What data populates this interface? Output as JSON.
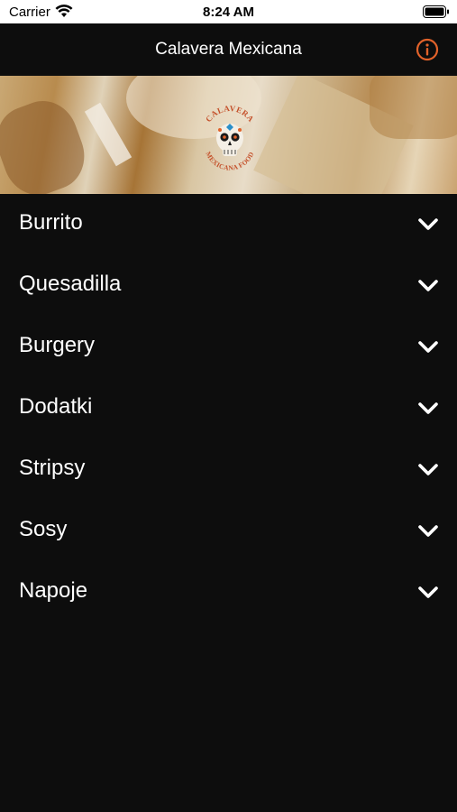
{
  "status": {
    "carrier": "Carrier",
    "time": "8:24 AM"
  },
  "header": {
    "title": "Calavera Mexicana",
    "info_icon": "info-circle-icon",
    "accent_color": "#e2622a"
  },
  "hero": {
    "logo_text_top": "CALAVERA",
    "logo_text_bottom": "MEXICANA FOOD"
  },
  "menu": {
    "items": [
      {
        "label": "Burrito"
      },
      {
        "label": "Quesadilla"
      },
      {
        "label": "Burgery"
      },
      {
        "label": "Dodatki"
      },
      {
        "label": "Stripsy"
      },
      {
        "label": "Sosy"
      },
      {
        "label": "Napoje"
      }
    ]
  }
}
